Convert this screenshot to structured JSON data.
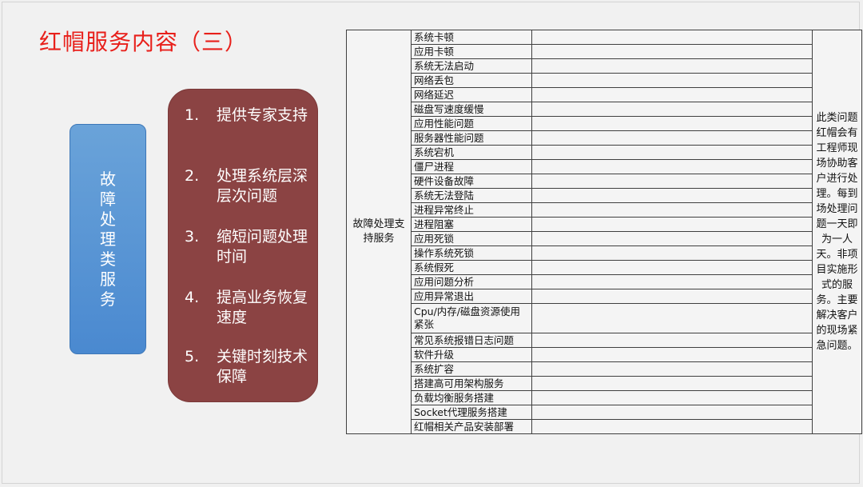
{
  "title": "红帽服务内容（三）",
  "category_label": "故障处理类服务",
  "features": [
    {
      "num": "1.",
      "text": "提供专家支持"
    },
    {
      "num": "2.",
      "text": "处理系统层深层次问题"
    },
    {
      "num": "3.",
      "text": "缩短问题处理时间"
    },
    {
      "num": "4.",
      "text": "提高业务恢复速度"
    },
    {
      "num": "5.",
      "text": "关键时刻技术保障"
    }
  ],
  "table": {
    "group": "故障处理支持服务",
    "items": [
      "系统卡顿",
      "应用卡顿",
      "系统无法启动",
      "网络丢包",
      "网络延迟",
      "磁盘写速度缓慢",
      "应用性能问题",
      "服务器性能问题",
      "系统宕机",
      "僵尸进程",
      "硬件设备故障",
      "系统无法登陆",
      "进程异常终止",
      "进程阻塞",
      "应用死锁",
      "操作系统死锁",
      "系统假死",
      "应用问题分析",
      "应用异常退出",
      "Cpu/内存/磁盘资源使用紧张",
      "常见系统报错日志问题",
      "软件升级",
      "系统扩容",
      "搭建高可用架构服务",
      "负载均衡服务搭建",
      "Socket代理服务搭建",
      "红帽相关产品安装部署"
    ],
    "note": "此类问题红帽会有工程师现场协助客户进行处理。每到场处理问题一天即为一人天。非项目实施形式的服务。主要解决客户的现场紧急问题。"
  },
  "colors": {
    "title": "#e8201b",
    "category_box": "#4a89d0",
    "feature_box": "#8b4343"
  }
}
